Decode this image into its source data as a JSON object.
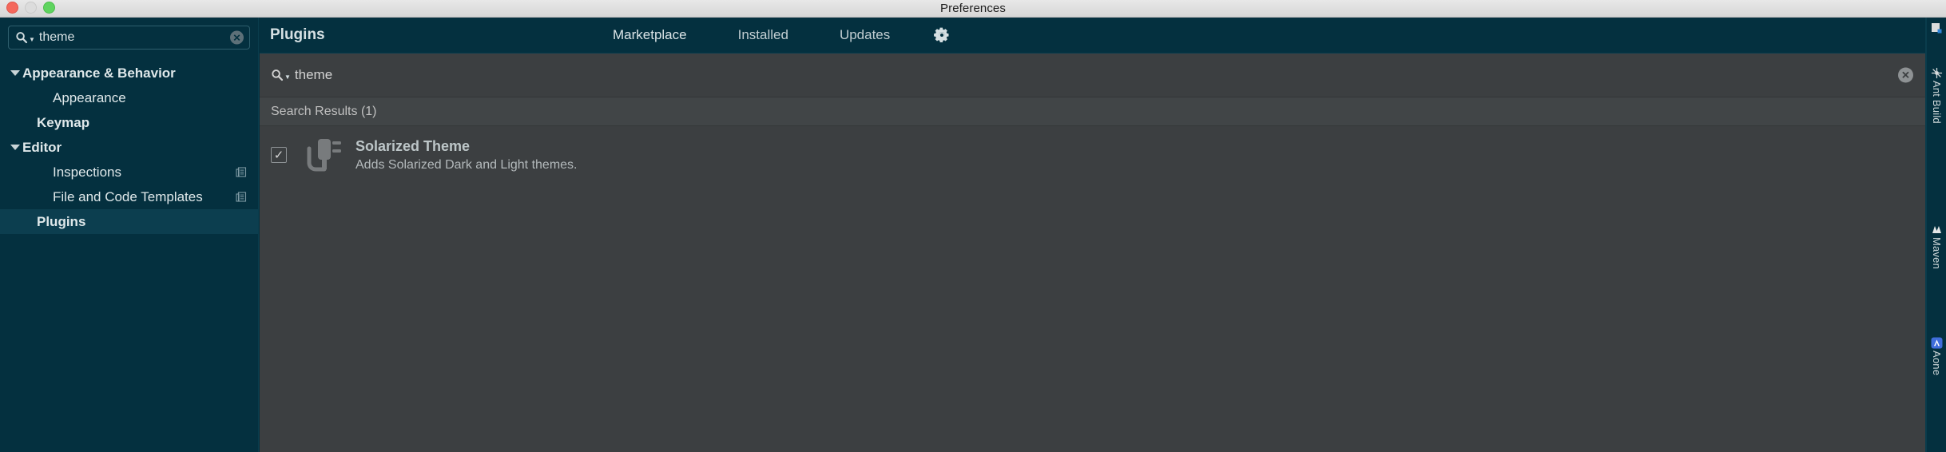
{
  "window": {
    "title": "Preferences",
    "traffic_lights": [
      "close",
      "minimize",
      "zoom"
    ]
  },
  "sidebar": {
    "search": {
      "value": "theme",
      "icon": "search-icon",
      "clear_icon": "clear-icon"
    },
    "items": [
      {
        "label": "Appearance & Behavior",
        "level": 0,
        "expanded": true,
        "selected": false,
        "config_icon": false
      },
      {
        "label": "Appearance",
        "level": 1,
        "expanded": null,
        "selected": false,
        "config_icon": false
      },
      {
        "label": "Keymap",
        "level": 0,
        "expanded": null,
        "selected": false,
        "config_icon": false
      },
      {
        "label": "Editor",
        "level": 0,
        "expanded": true,
        "selected": false,
        "config_icon": false
      },
      {
        "label": "Inspections",
        "level": 1,
        "expanded": null,
        "selected": false,
        "config_icon": true
      },
      {
        "label": "File and Code Templates",
        "level": 1,
        "expanded": null,
        "selected": false,
        "config_icon": true
      },
      {
        "label": "Plugins",
        "level": 0,
        "expanded": null,
        "selected": true,
        "config_icon": false
      }
    ]
  },
  "main": {
    "panel_title": "Plugins",
    "tabs": [
      {
        "label": "Marketplace",
        "active": true
      },
      {
        "label": "Installed",
        "active": false
      },
      {
        "label": "Updates",
        "active": false
      }
    ],
    "settings_icon": "gear-icon",
    "search": {
      "value": "theme",
      "icon": "search-icon",
      "clear_icon": "clear-icon"
    },
    "results_header": "Search Results (1)",
    "plugins": [
      {
        "name": "Solarized Theme",
        "description": "Adds Solarized Dark and Light themes.",
        "enabled": true,
        "icon": "plugin-plug-icon"
      }
    ]
  },
  "toolstrip": {
    "items": [
      {
        "label": "",
        "icon": "structure-icon"
      },
      {
        "label": "Ant Build",
        "icon": "ant-icon"
      },
      {
        "label": "Maven",
        "icon": "maven-icon"
      },
      {
        "label": "Aone",
        "icon": "aone-icon"
      }
    ]
  },
  "colors": {
    "sidebar_bg": "#04303f",
    "panel_bg": "#3c3f41",
    "titlebar_bg": "#e0e0e0",
    "selected_row": "#0c3e4f",
    "text_light": "#d8e2e5"
  }
}
